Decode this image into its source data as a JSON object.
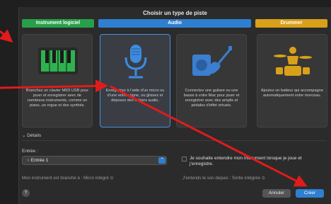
{
  "dialog": {
    "title": "Choisir un type de piste"
  },
  "categories": [
    {
      "label": "Instrument logiciel",
      "color": "#27a04a"
    },
    {
      "label": "Audio",
      "color": "#2f7fd0"
    },
    {
      "label": "Drummer",
      "color": "#d9a019"
    }
  ],
  "tiles": [
    {
      "name": "piano-keyboard-icon",
      "desc": "Branchez un clavier MIDI USB pour jouer et enregistrer avec de nombreux instruments, comme un piano, un orgue et des synthés.",
      "selected": false
    },
    {
      "name": "microphone-icon",
      "desc": "Enregistrez à l’aide d’un micro ou d’une entrée ligne, ou glissez et déposez des fichiers audio.",
      "selected": true
    },
    {
      "name": "guitar-icon",
      "desc": "Connectez une guitare ou une basse à votre Mac pour jouer et enregistrer avec des amplis et pédales d’effet virtuels.",
      "selected": false
    },
    {
      "name": "drummer-icon",
      "desc": "Ajoutez un batteur qui accompagne automatiquement votre morceau.",
      "selected": false
    }
  ],
  "details": {
    "label": "Détails",
    "input_label": "Entrée :",
    "input_value": "Entrée 1",
    "monitor_text": "Je souhaite entendre mon instrument lorsque je joue et j’enregistre.",
    "instrument_info": "Mon instrument est branché à : Micro intégré",
    "output_info": "J’entends le son depuis : Sortie intégrée"
  },
  "footer": {
    "help": "?",
    "cancel": "Annuler",
    "create": "Créer"
  },
  "colors": {
    "accent": "#2f7fd0",
    "annotation": "#e01b1b"
  }
}
